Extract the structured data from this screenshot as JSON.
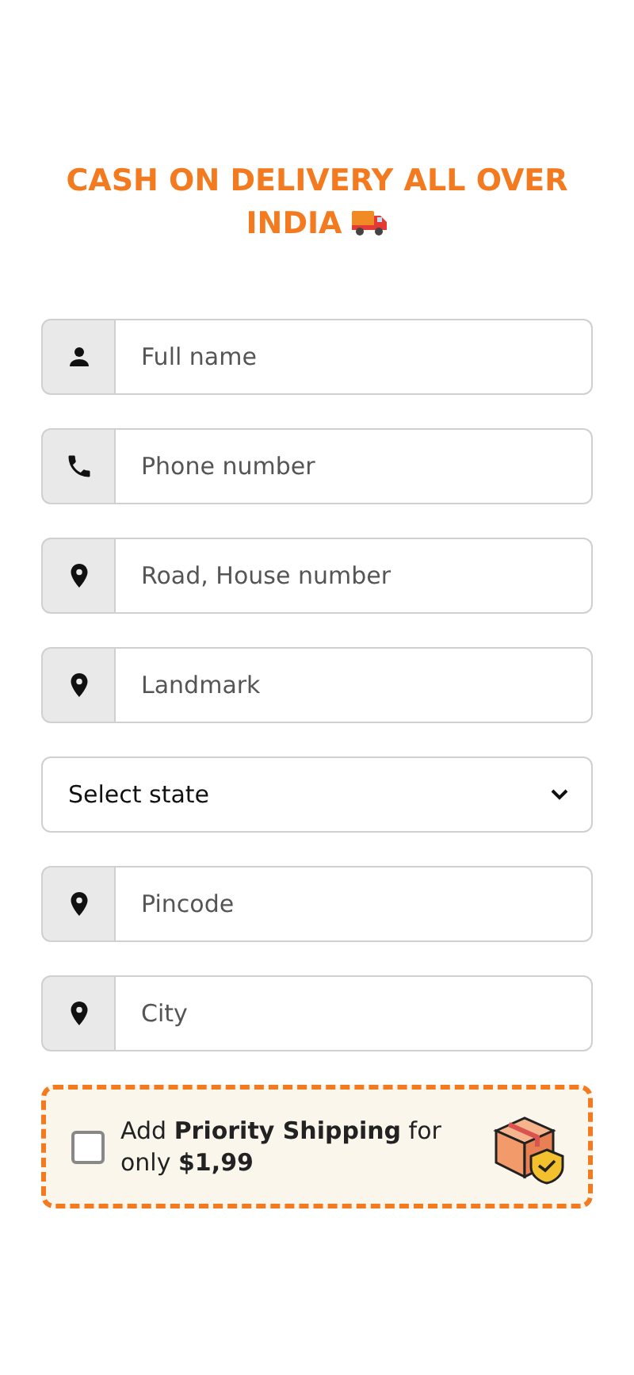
{
  "heading_lines": [
    "CASH ON DELIVERY ALL OVER",
    "INDIA"
  ],
  "fields": [
    {
      "kind": "name",
      "placeholder": "Full name"
    },
    {
      "kind": "phone",
      "placeholder": "Phone number"
    },
    {
      "kind": "address",
      "placeholder": "Road, House number"
    },
    {
      "kind": "address",
      "placeholder": "Landmark"
    },
    {
      "kind": "select",
      "value": "Select state"
    },
    {
      "kind": "address",
      "placeholder": "Pincode"
    },
    {
      "kind": "address",
      "placeholder": "City"
    }
  ],
  "upsell": {
    "checked": false,
    "text": "Add **Priority Shipping** for only **$1,99**"
  }
}
